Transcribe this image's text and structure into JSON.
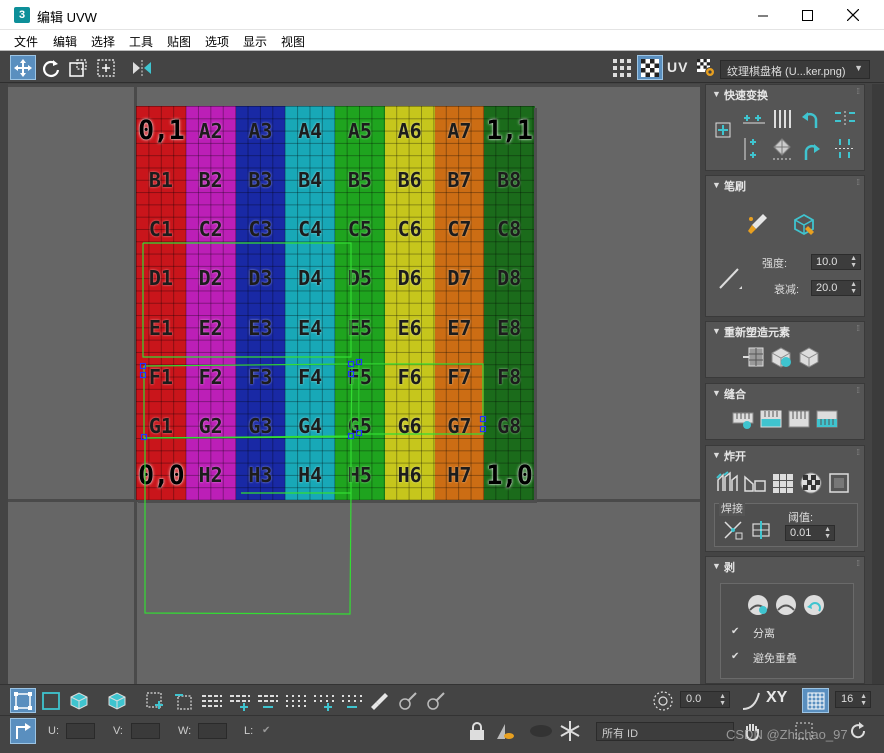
{
  "window": {
    "app_icon_label": "3",
    "title": "编辑 UVW"
  },
  "menu": [
    "文件",
    "编辑",
    "选择",
    "工具",
    "贴图",
    "选项",
    "显示",
    "视图"
  ],
  "toolbar_top": {
    "uv_label": "UV",
    "texture_dropdown": "纹理棋盘格 (U...ker.png)"
  },
  "checker_map": {
    "columns": [
      {
        "color": "#c9151b"
      },
      {
        "color": "#bc1fb7"
      },
      {
        "color": "#1929a5"
      },
      {
        "color": "#18a8b7"
      },
      {
        "color": "#1fa41f"
      },
      {
        "color": "#c6c61c"
      },
      {
        "color": "#cc6d14"
      },
      {
        "color": "#1b6b1b"
      }
    ],
    "rows": [
      [
        "0,1",
        "A2",
        "A3",
        "A4",
        "A5",
        "A6",
        "A7",
        "1,1"
      ],
      [
        "B1",
        "B2",
        "B3",
        "B4",
        "B5",
        "B6",
        "B7",
        "B8"
      ],
      [
        "C1",
        "C2",
        "C3",
        "C4",
        "C5",
        "C6",
        "C7",
        "C8"
      ],
      [
        "D1",
        "D2",
        "D3",
        "D4",
        "D5",
        "D6",
        "D7",
        "D8"
      ],
      [
        "E1",
        "E2",
        "E3",
        "E4",
        "E5",
        "E6",
        "E7",
        "E8"
      ],
      [
        "F1",
        "F2",
        "F3",
        "F4",
        "F5",
        "F6",
        "F7",
        "F8"
      ],
      [
        "G1",
        "G2",
        "G3",
        "G4",
        "G5",
        "G6",
        "G7",
        "G8"
      ],
      [
        "0,0",
        "H2",
        "H3",
        "H4",
        "H5",
        "H6",
        "H7",
        "1,0"
      ]
    ],
    "wire_color": "#33dd33",
    "vertex_color": "#2233ff"
  },
  "panel": {
    "quick_transform": {
      "title": "快速变换"
    },
    "brush": {
      "title": "笔刷",
      "strength_label": "强度:",
      "strength_value": "10.0",
      "falloff_label": "衰减:",
      "falloff_value": "20.0"
    },
    "reshape": {
      "title": "重新塑造元素"
    },
    "stitch": {
      "title": "缝合"
    },
    "explode": {
      "title": "炸开",
      "weld_label": "焊接",
      "threshold_label": "阈值:",
      "threshold_value": "0.01"
    },
    "peel": {
      "title": "剥",
      "detach_label": "分离",
      "avoid_overlap_label": "避免重叠"
    }
  },
  "bottom": {
    "angle_value": "0.0",
    "xy_label": "XY",
    "count_value": "16",
    "u_label": "U:",
    "v_label": "V:",
    "w_label": "W:",
    "l_label": "L:",
    "selection_id": "所有 ID",
    "watermark": "CSDN @Zhichao_97"
  },
  "colors": {
    "accent": "#3fc4cf",
    "panel_bg": "#555555",
    "ui_bg": "#444444",
    "viewport_bg": "#666666"
  }
}
